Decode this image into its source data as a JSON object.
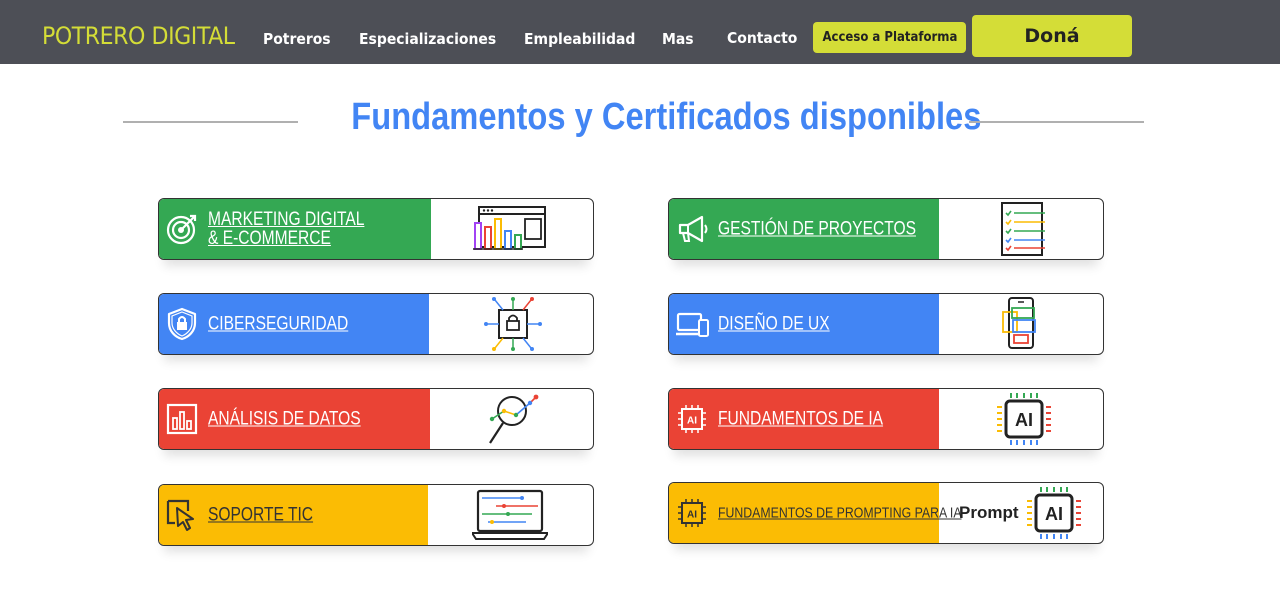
{
  "navbar": {
    "logo": "POTRERO DIGITAL",
    "links": [
      "Potreros",
      "Especializaciones",
      "Empleabilidad",
      "Mas",
      "Contacto"
    ],
    "access_button": "Acceso a Plataforma",
    "donate_button": "Doná"
  },
  "section": {
    "title": "Fundamentos y Certificados disponibles"
  },
  "cards": [
    {
      "label": "MARKETING DIGITAL\n& E-COMMERCE",
      "color": "#34a853",
      "icon": "target-icon"
    },
    {
      "label": "GESTIÓN DE PROYECTOS",
      "color": "#34a853",
      "icon": "megaphone-icon"
    },
    {
      "label": "CIBERSEGURIDAD",
      "color": "#4285f4",
      "icon": "shield-lock-icon"
    },
    {
      "label": "DISEÑO DE UX",
      "color": "#4285f4",
      "icon": "devices-icon"
    },
    {
      "label": "ANÁLISIS DE DATOS",
      "color": "#ea4335",
      "icon": "bar-chart-icon"
    },
    {
      "label": "FUNDAMENTOS DE IA",
      "color": "#ea4335",
      "icon": "ai-chip-icon"
    },
    {
      "label": "SOPORTE TIC",
      "color": "#fbbc04",
      "icon": "cursor-icon"
    },
    {
      "label": "FUNDAMENTOS DE PROMPTING PARA IA",
      "color": "#fbbc04",
      "icon": "ai-chip-icon"
    }
  ],
  "illustrations": {
    "ai_badge": "AI",
    "prompt_label": "Prompt"
  }
}
